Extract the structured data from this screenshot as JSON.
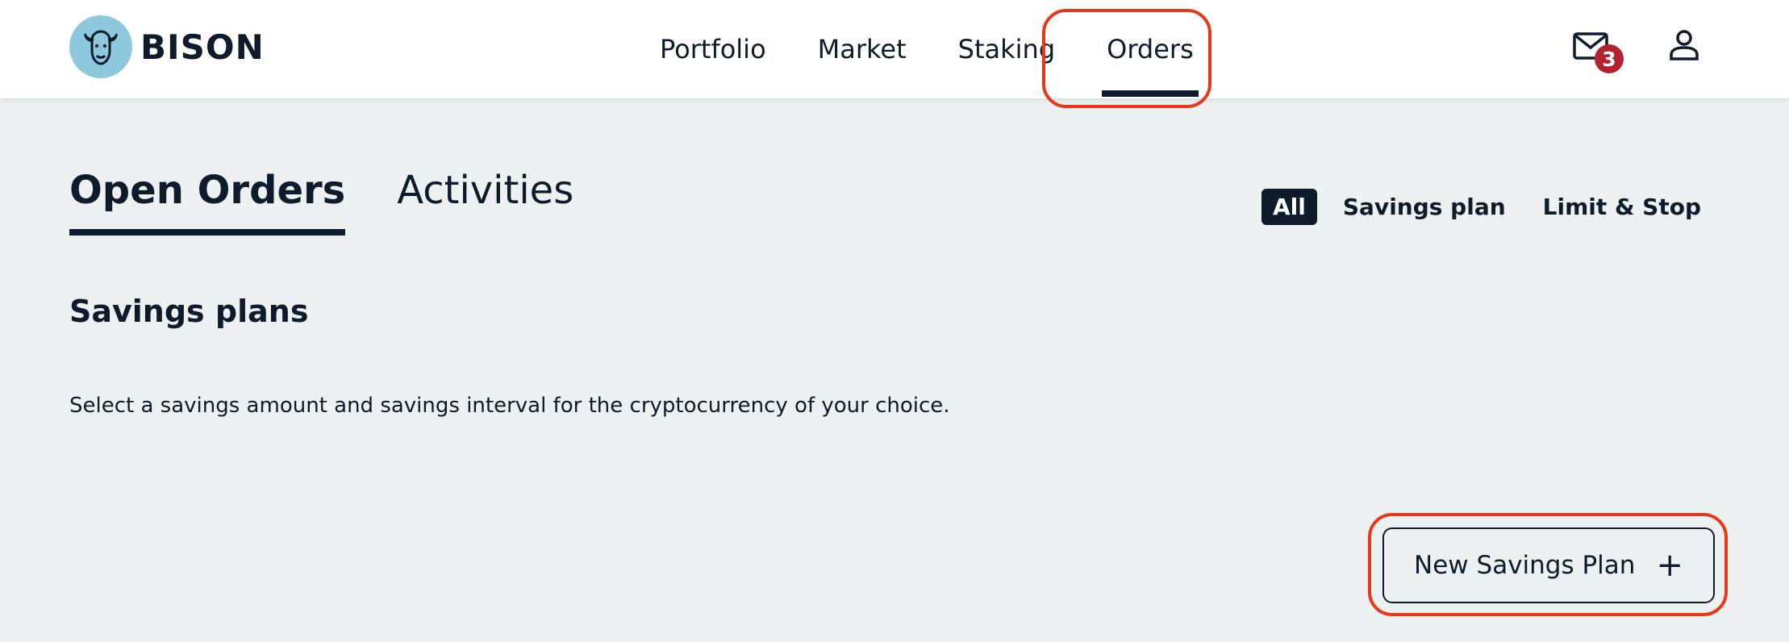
{
  "header": {
    "brand": "BISON",
    "nav": [
      {
        "label": "Portfolio",
        "active": false
      },
      {
        "label": "Market",
        "active": false
      },
      {
        "label": "Staking",
        "active": false
      },
      {
        "label": "Orders",
        "active": true
      }
    ],
    "mail_badge": "3",
    "icons": {
      "mail": "mail-icon",
      "user": "user-icon",
      "logo": "bison-logo"
    }
  },
  "tabs": [
    {
      "label": "Open Orders",
      "active": true
    },
    {
      "label": "Activities",
      "active": false
    }
  ],
  "filters": [
    {
      "label": "All",
      "active": true
    },
    {
      "label": "Savings plan",
      "active": false
    },
    {
      "label": "Limit & Stop",
      "active": false
    }
  ],
  "section": {
    "title": "Savings plans",
    "description": "Select a savings amount and savings interval for the cryptocurrency of your choice.",
    "new_button_label": "New Savings Plan",
    "new_button_icon": "plus-icon"
  },
  "colors": {
    "highlight": "#e8381a",
    "navy": "#0d1b2a",
    "badge": "#b3232f",
    "background": "#eef1f2"
  }
}
